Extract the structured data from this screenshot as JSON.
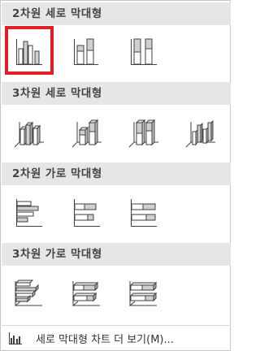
{
  "sections": [
    {
      "title": "2차원 세로 막대형",
      "items": [
        {
          "name": "clustered-column",
          "icon": "clustered-column-icon",
          "selected": true
        },
        {
          "name": "stacked-column",
          "icon": "stacked-column-icon",
          "selected": false
        },
        {
          "name": "100-stacked-column",
          "icon": "100-stacked-column-icon",
          "selected": false
        }
      ]
    },
    {
      "title": "3차원 세로 막대형",
      "items": [
        {
          "name": "3d-clustered-column",
          "icon": "3d-clustered-column-icon"
        },
        {
          "name": "3d-stacked-column",
          "icon": "3d-stacked-column-icon"
        },
        {
          "name": "3d-100-stacked-column",
          "icon": "3d-100-stacked-column-icon"
        },
        {
          "name": "3d-column",
          "icon": "3d-column-icon"
        }
      ]
    },
    {
      "title": "2차원 가로 막대형",
      "items": [
        {
          "name": "clustered-bar",
          "icon": "clustered-bar-icon"
        },
        {
          "name": "stacked-bar",
          "icon": "stacked-bar-icon"
        },
        {
          "name": "100-stacked-bar",
          "icon": "100-stacked-bar-icon"
        }
      ]
    },
    {
      "title": "3차원 가로 막대형",
      "items": [
        {
          "name": "3d-clustered-bar",
          "icon": "3d-clustered-bar-icon"
        },
        {
          "name": "3d-stacked-bar",
          "icon": "3d-stacked-bar-icon"
        },
        {
          "name": "3d-100-stacked-bar",
          "icon": "3d-100-stacked-bar-icon"
        }
      ]
    }
  ],
  "footer": {
    "label": "세로 막대형 차트 더 보기(M)...",
    "icon": "bar-chart-more-icon"
  },
  "colors": {
    "header_bg": "#e6e6e6",
    "selection_border": "#e21f26",
    "bar_fill": "#d0d0d0",
    "bar_stroke": "#404040"
  }
}
